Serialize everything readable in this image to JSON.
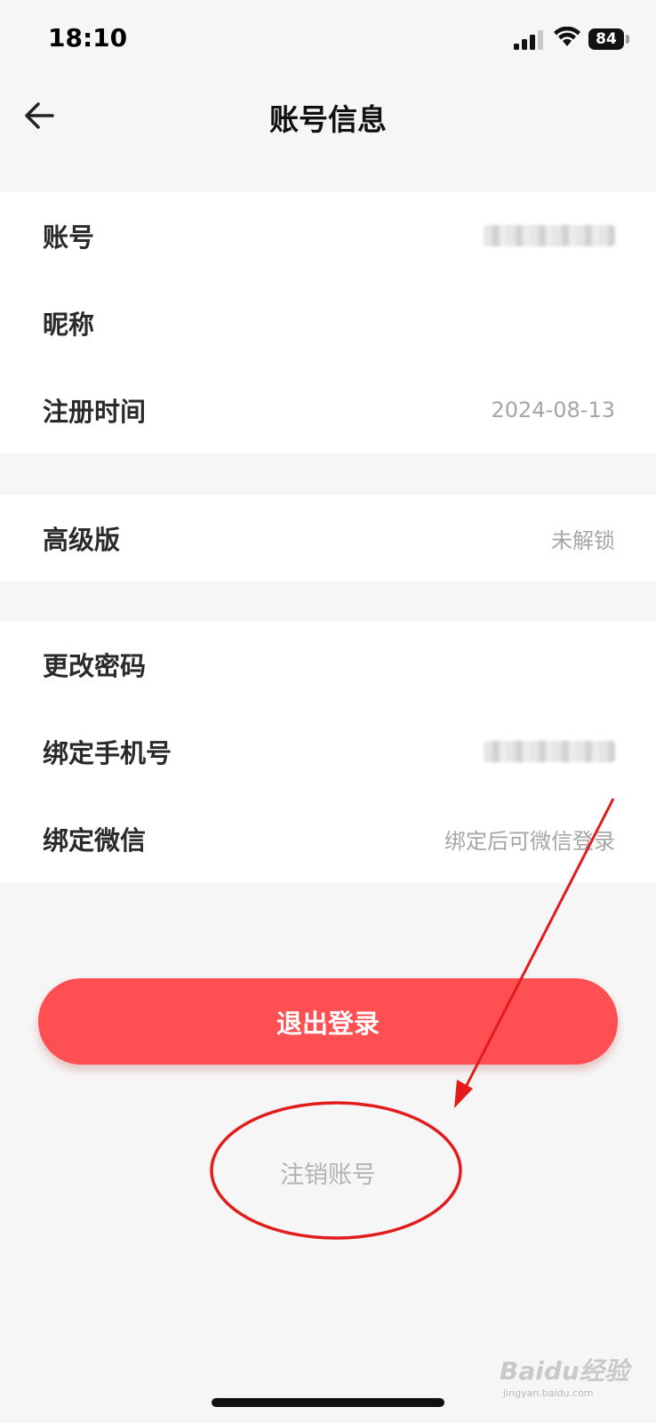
{
  "status_bar": {
    "time": "18:10",
    "battery": "84"
  },
  "header": {
    "title": "账号信息"
  },
  "groups": [
    {
      "rows": [
        {
          "label": "账号",
          "value": ""
        },
        {
          "label": "昵称",
          "value": ""
        },
        {
          "label": "注册时间",
          "value": "2024-08-13"
        }
      ]
    },
    {
      "rows": [
        {
          "label": "高级版",
          "value": "未解锁"
        }
      ]
    },
    {
      "rows": [
        {
          "label": "更改密码",
          "value": ""
        },
        {
          "label": "绑定手机号",
          "value": ""
        },
        {
          "label": "绑定微信",
          "value": "绑定后可微信登录"
        }
      ]
    }
  ],
  "actions": {
    "logout_label": "退出登录",
    "cancel_account_label": "注销账号"
  },
  "watermark": {
    "brand": "Baidu经验",
    "url": "jingyan.baidu.com"
  },
  "colors": {
    "accent": "#fe5052",
    "annotation": "#e31b1b"
  },
  "icons": {
    "back": "arrow-left-icon",
    "signal": "signal-icon",
    "wifi": "wifi-icon"
  }
}
